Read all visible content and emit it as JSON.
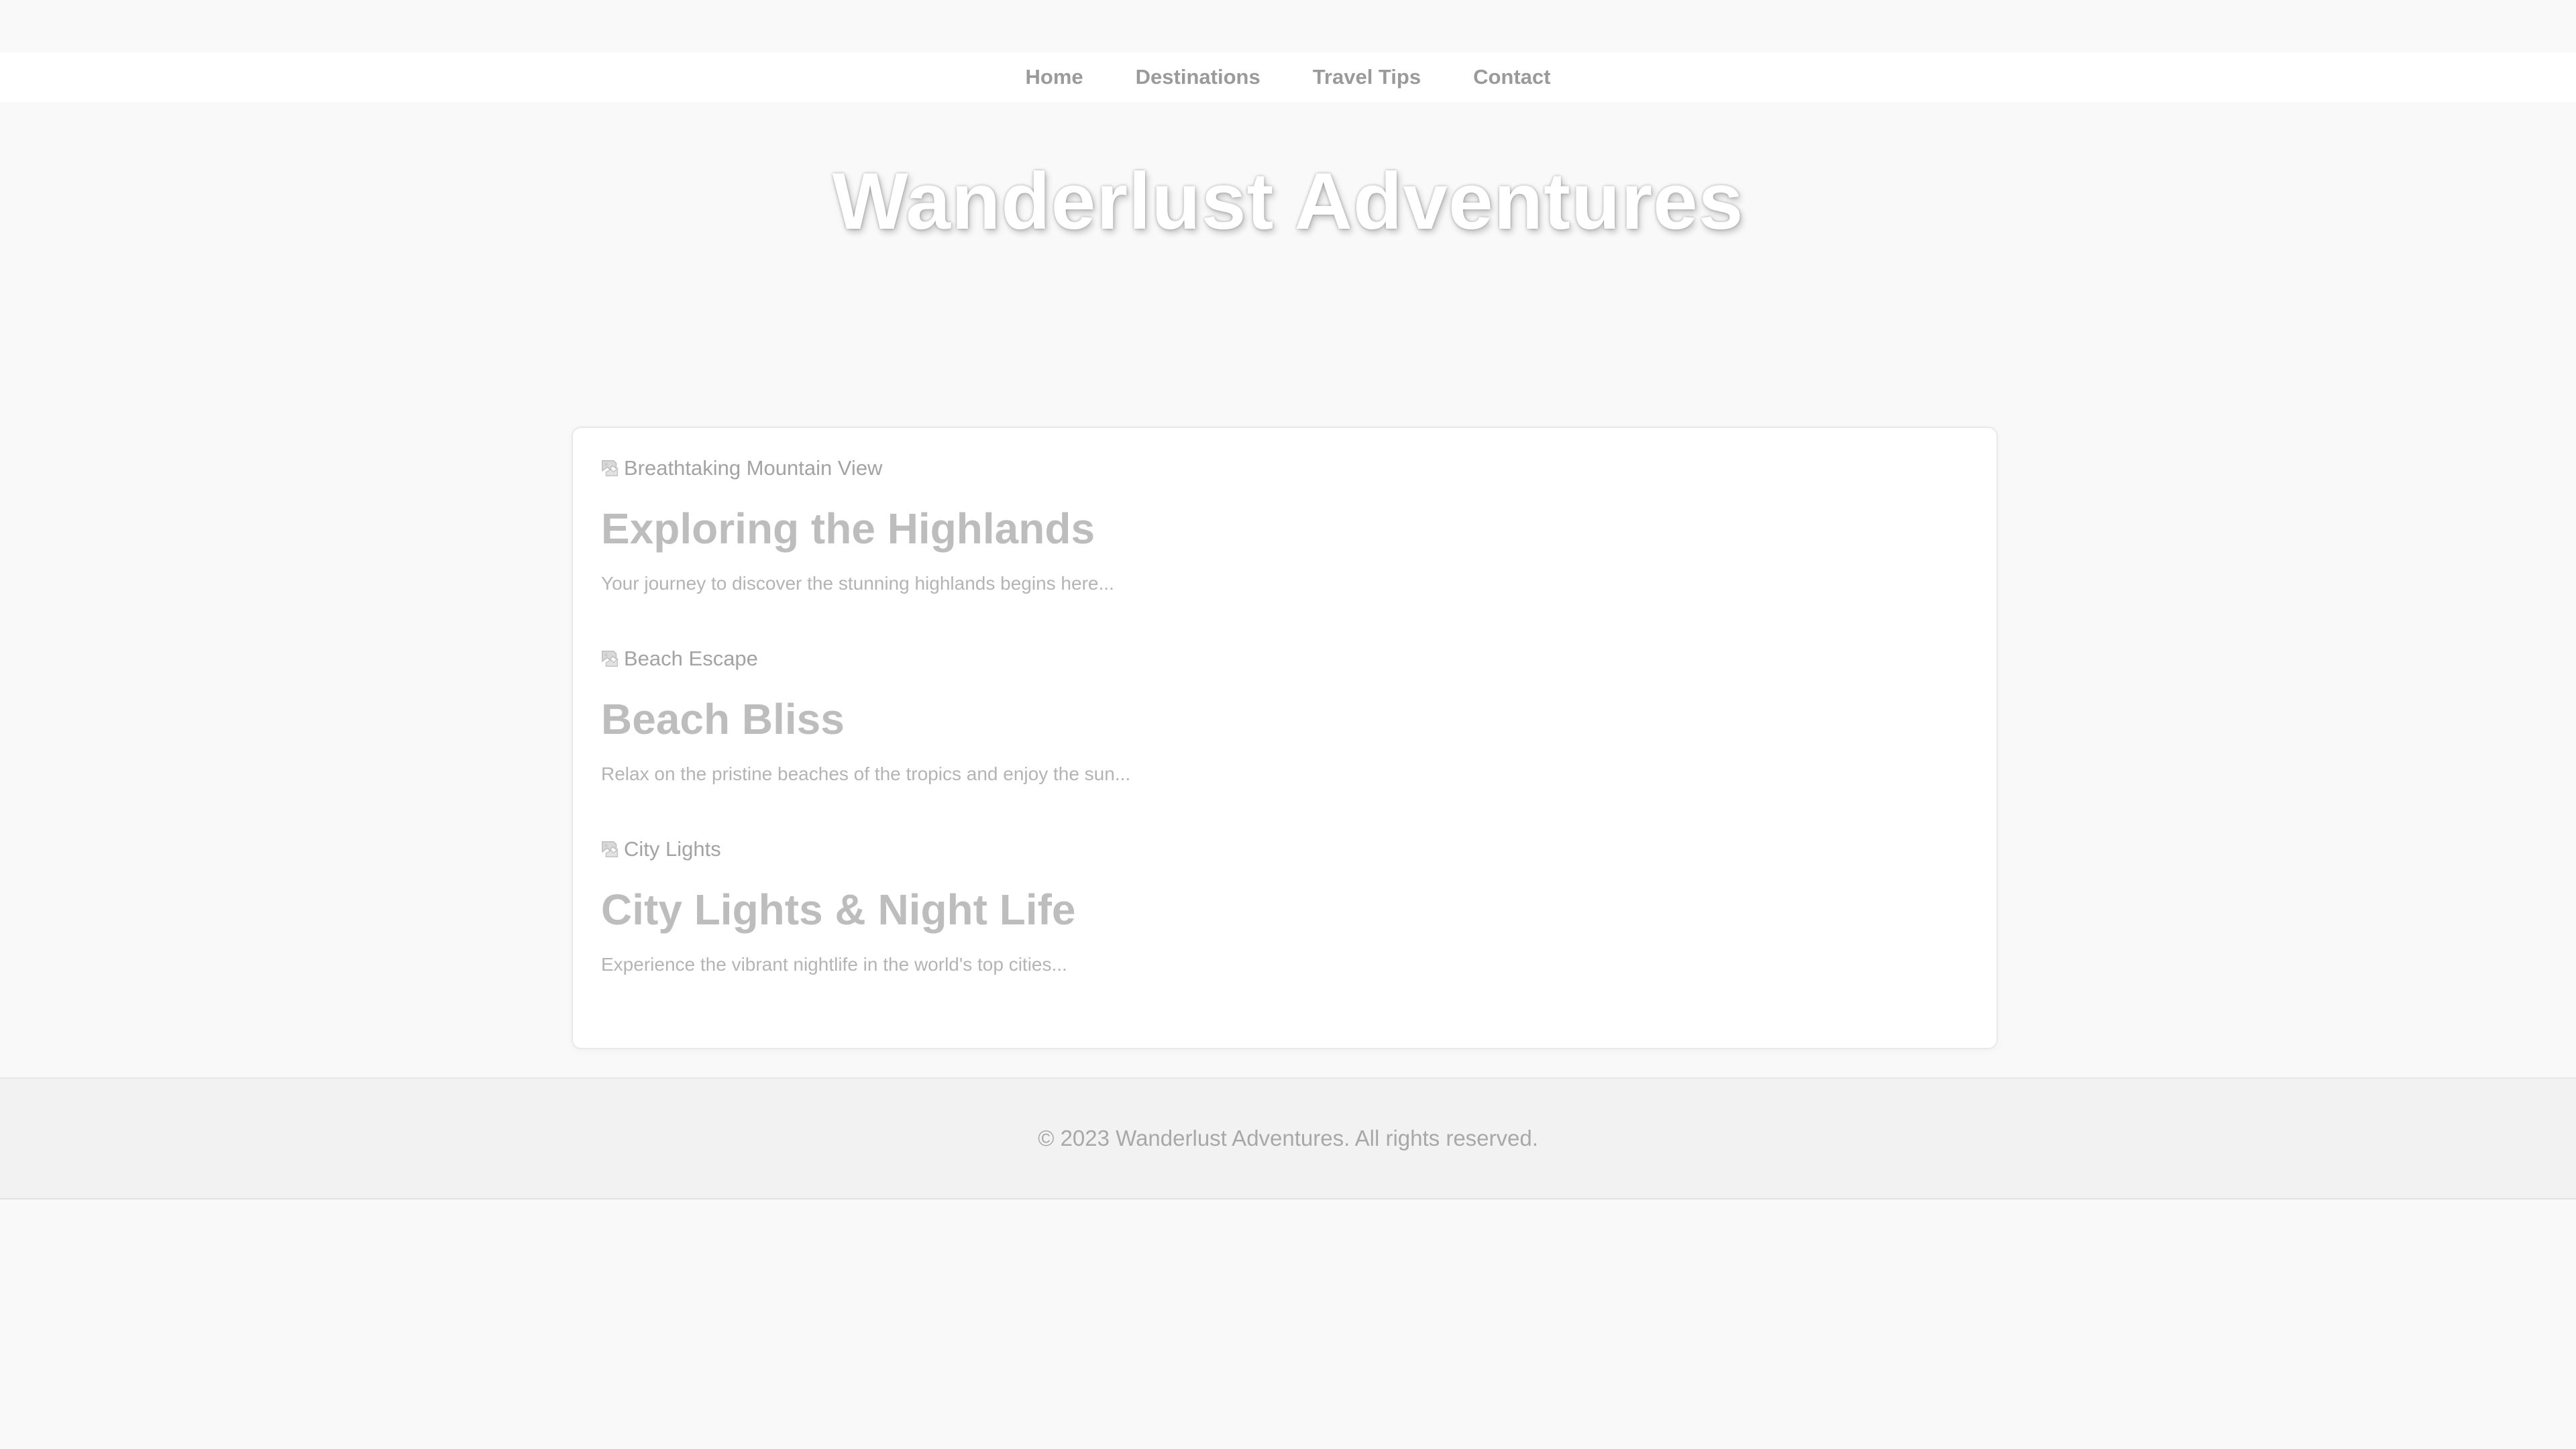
{
  "nav": {
    "items": [
      {
        "label": "Home"
      },
      {
        "label": "Destinations"
      },
      {
        "label": "Travel Tips"
      },
      {
        "label": "Contact"
      }
    ]
  },
  "header": {
    "title": "Wanderlust Adventures"
  },
  "posts": [
    {
      "image_alt": "Breathtaking Mountain View",
      "title": "Exploring the Highlands",
      "excerpt": "Your journey to discover the stunning highlands begins here..."
    },
    {
      "image_alt": "Beach Escape",
      "title": "Beach Bliss",
      "excerpt": "Relax on the pristine beaches of the tropics and enjoy the sun..."
    },
    {
      "image_alt": "City Lights",
      "title": "City Lights & Night Life",
      "excerpt": "Experience the vibrant nightlife in the world's top cities..."
    }
  ],
  "footer": {
    "text": "© 2023 Wanderlust Adventures. All rights reserved."
  },
  "icons": {
    "post_image": "broken-image-icon"
  },
  "colors": {
    "page_background": "#f9f9f9",
    "nav_background": "#ffffff",
    "nav_text": "#9a9a9a",
    "hero_title": "#ffffff",
    "post_title": "#bdbdbd",
    "post_text": "#b4b4b4",
    "footer_background": "#f2f2f2"
  }
}
